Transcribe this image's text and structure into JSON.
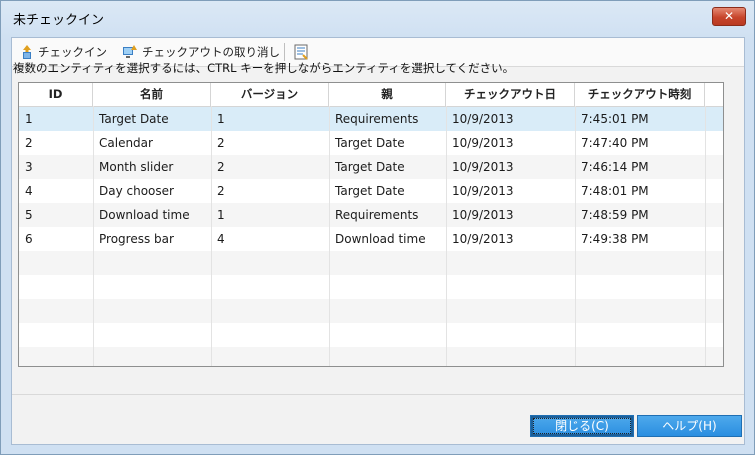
{
  "window": {
    "title": "未チェックイン",
    "close_glyph": "✕"
  },
  "toolbar": {
    "checkin_label": "チェックイン",
    "undo_checkout_label": "チェックアウトの取り消し"
  },
  "instruction": "複数のエンティティを選択するには、CTRL キーを押しながらエンティティを選択してください。",
  "table": {
    "columns": [
      "ID",
      "名前",
      "バージョン",
      "親",
      "チェックアウト日",
      "チェックアウト時刻"
    ],
    "rows": [
      [
        "1",
        "Target Date",
        "1",
        "Requirements",
        "10/9/2013",
        "7:45:01 PM"
      ],
      [
        "2",
        "Calendar",
        "2",
        "Target Date",
        "10/9/2013",
        "7:47:40 PM"
      ],
      [
        "3",
        "Month slider",
        "2",
        "Target Date",
        "10/9/2013",
        "7:46:14 PM"
      ],
      [
        "4",
        "Day chooser",
        "2",
        "Target Date",
        "10/9/2013",
        "7:48:01 PM"
      ],
      [
        "5",
        "Download time",
        "1",
        "Requirements",
        "10/9/2013",
        "7:48:59 PM"
      ],
      [
        "6",
        "Progress bar",
        "4",
        "Download time",
        "10/9/2013",
        "7:49:38 PM"
      ]
    ]
  },
  "buttons": {
    "close_label": "閉じる(C)",
    "help_label": "ヘルプ(H)"
  },
  "colors": {
    "selected_row": "#d9ecf8",
    "button": "#2a8ee0",
    "close": "#c7452c"
  },
  "icons": {
    "checkin": "checkin-icon",
    "undo_checkout": "undo-checkout-icon",
    "details": "details-icon"
  }
}
